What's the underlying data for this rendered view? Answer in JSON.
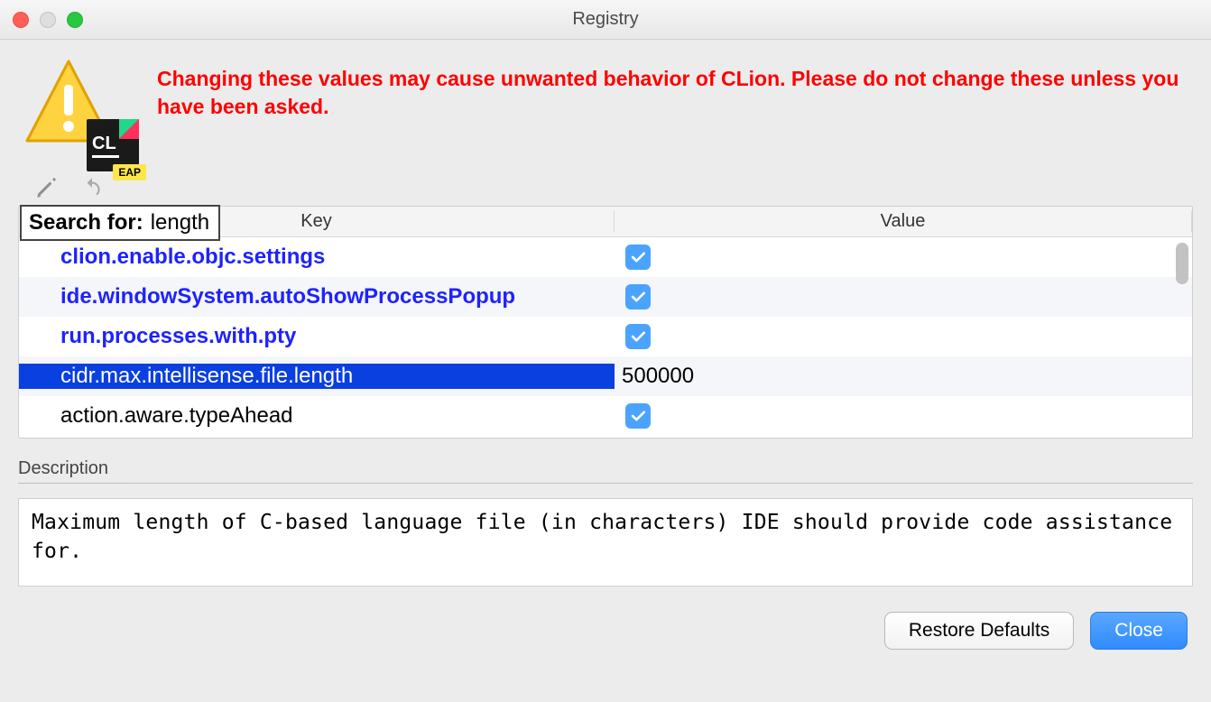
{
  "title": "Registry",
  "warning_text": "Changing these values may cause unwanted behavior of CLion. Please do not change these unless you have been asked.",
  "product_badge": {
    "label": "CL",
    "tag": "EAP"
  },
  "search": {
    "label": "Search for:",
    "term": "length"
  },
  "table": {
    "columns": {
      "key": "Key",
      "value": "Value"
    },
    "rows": [
      {
        "key": "clion.enable.objc.settings",
        "type": "bool",
        "value": true,
        "modified": false,
        "selected": false
      },
      {
        "key": "ide.windowSystem.autoShowProcessPopup",
        "type": "bool",
        "value": true,
        "modified": false,
        "selected": false
      },
      {
        "key": "run.processes.with.pty",
        "type": "bool",
        "value": true,
        "modified": false,
        "selected": false
      },
      {
        "key": "cidr.max.intellisense.file.length",
        "type": "text",
        "value": "500000",
        "modified": true,
        "selected": true
      },
      {
        "key": "action.aware.typeAhead",
        "type": "bool",
        "value": true,
        "modified": true,
        "selected": false
      }
    ]
  },
  "description": {
    "label": "Description",
    "text": "Maximum length of C-based language file (in characters) IDE should provide code assistance for."
  },
  "buttons": {
    "restore": "Restore Defaults",
    "close": "Close"
  }
}
